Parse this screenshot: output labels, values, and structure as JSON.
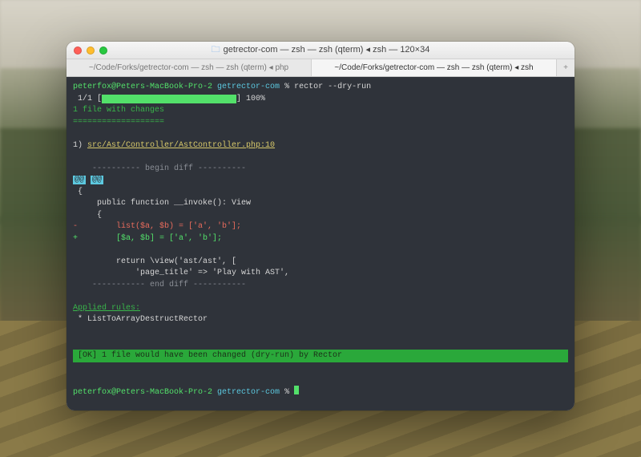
{
  "window": {
    "title": "getrector-com — zsh — zsh (qterm) ◂ zsh — 120×34"
  },
  "tabs": [
    {
      "label": "~/Code/Forks/getrector-com — zsh — zsh (qterm) ◂ php"
    },
    {
      "label": "~/Code/Forks/getrector-com — zsh — zsh (qterm) ◂ zsh"
    }
  ],
  "newtab_label": "+",
  "term": {
    "prompt_user": "peterfox@Peters-MacBook-Pro-2",
    "prompt_dir": "getrector-com",
    "prompt_sym": " % ",
    "command": "rector --dry-run",
    "progress_prefix": " 1/1 [",
    "progress_bar": "============================",
    "progress_suffix": "] 100%",
    "changes": "1 file with changes",
    "sep": "===================",
    "file_heading_num": "1) ",
    "file_heading_path": "src/Ast/Controller/AstController.php:10",
    "begin_diff": "    ---------- begin diff ----------",
    "at1": "@@",
    "at2": "@@",
    "brace_open": " {",
    "fn_line": "     public function __invoke(): View",
    "brace2": "     {",
    "minus": "-",
    "minus_code_a": "        list($a, $b) = ['a', 'b'];",
    "plus": "+",
    "plus_code": "        [$a, $b] = ['a', 'b'];",
    "blank": "",
    "ret1": "         return \\view('ast/ast', [",
    "ret2": "             'page_title' => 'Play with AST',",
    "end_diff": "    ----------- end diff -----------",
    "applied_head": "Applied rules:",
    "applied_rule": " * ListToArrayDestructRector",
    "ok": " [OK] 1 file would have been changed (dry-run) by Rector",
    "prompt2_user": "peterfox@Peters-MacBook-Pro-2",
    "prompt2_dir": "getrector-com"
  }
}
